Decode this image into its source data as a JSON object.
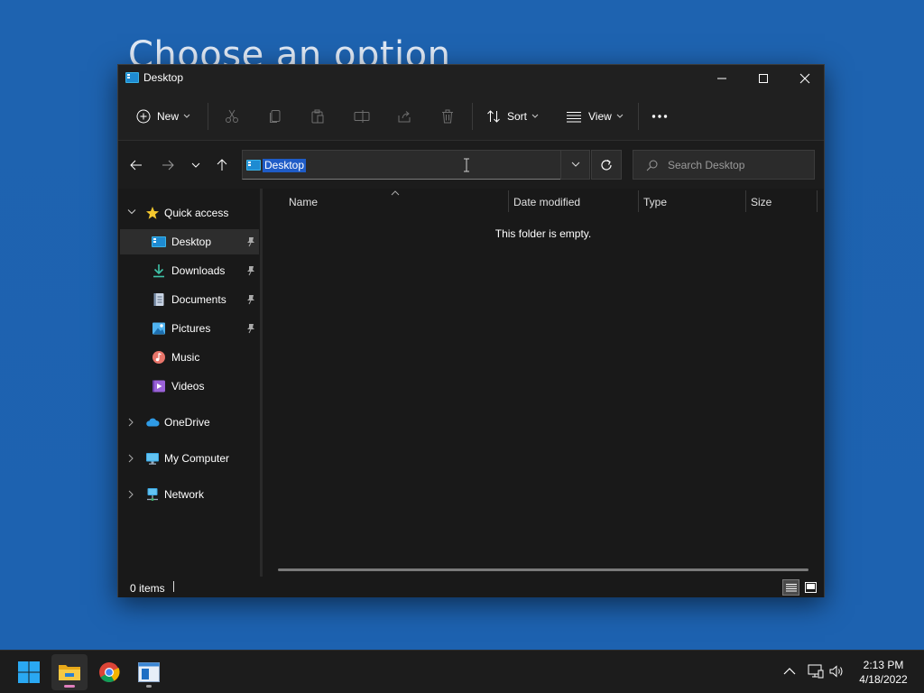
{
  "background": {
    "title": "Choose an option"
  },
  "window": {
    "title": "Desktop",
    "controls": {
      "minimize": "minimize",
      "maximize": "maximize",
      "close": "close"
    }
  },
  "toolbar": {
    "new_label": "New",
    "sort_label": "Sort",
    "view_label": "View",
    "icons": [
      "cut-icon",
      "copy-icon",
      "paste-icon",
      "rename-icon",
      "share-icon",
      "delete-icon",
      "more-icon"
    ]
  },
  "address": {
    "path": "Desktop",
    "search_placeholder": "Search Desktop"
  },
  "sidebar": {
    "quick_access": "Quick access",
    "items": [
      {
        "label": "Desktop",
        "pinned": true,
        "selected": true
      },
      {
        "label": "Downloads",
        "pinned": true
      },
      {
        "label": "Documents",
        "pinned": true
      },
      {
        "label": "Pictures",
        "pinned": true
      },
      {
        "label": "Music",
        "pinned": false
      },
      {
        "label": "Videos",
        "pinned": false
      }
    ],
    "groups": [
      {
        "label": "OneDrive"
      },
      {
        "label": "My Computer"
      },
      {
        "label": "Network"
      }
    ]
  },
  "content": {
    "columns": [
      "Name",
      "Date modified",
      "Type",
      "Size"
    ],
    "empty_message": "This folder is empty."
  },
  "status": {
    "item_count": "0 items"
  },
  "taskbar": {
    "apps": [
      "start",
      "file-explorer",
      "chrome",
      "notepad"
    ],
    "clock_time": "2:13 PM",
    "clock_date": "4/18/2022"
  },
  "colors": {
    "accent": "#1f5cc7",
    "desktop": "#1f66b5",
    "window_bg": "#191919"
  }
}
